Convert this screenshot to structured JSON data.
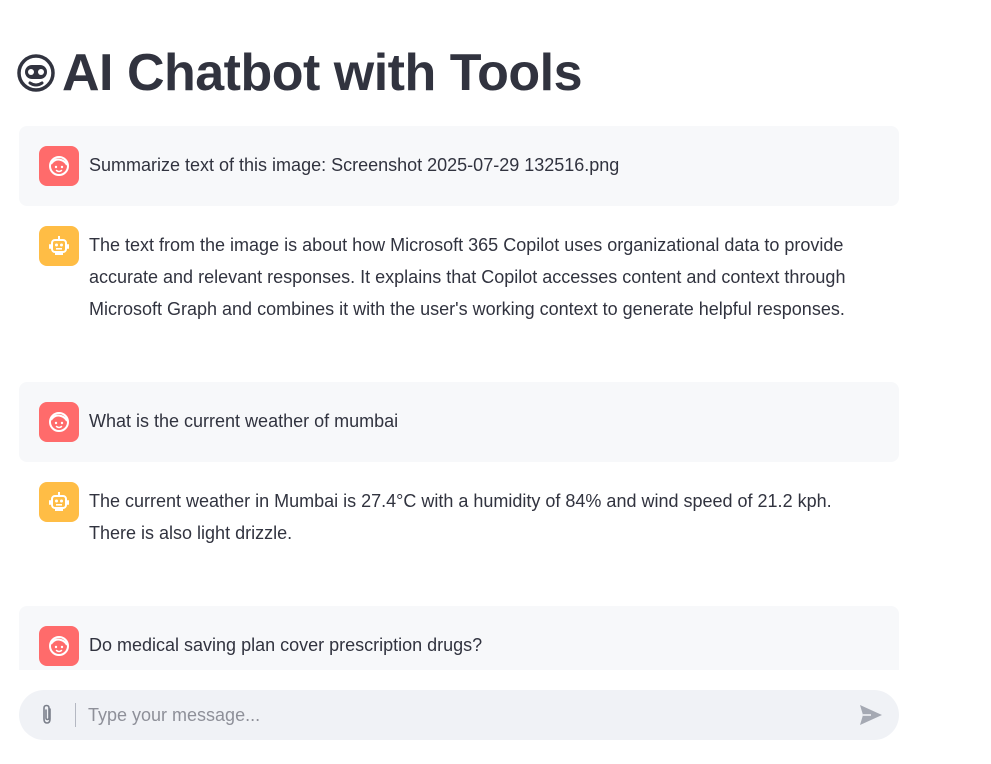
{
  "header": {
    "title": "AI Chatbot with Tools",
    "icon": "robot-face-icon"
  },
  "messages": [
    {
      "role": "user",
      "avatar_icon": "user-face-icon",
      "text": "Summarize text of this image: Screenshot 2025-07-29 132516.png"
    },
    {
      "role": "assistant",
      "avatar_icon": "robot-icon",
      "text": "The text from the image is about how Microsoft 365 Copilot uses organizational data to provide accurate and relevant responses. It explains that Copilot accesses content and context through Microsoft Graph and combines it with the user's working context to generate helpful responses."
    },
    {
      "role": "user",
      "avatar_icon": "user-face-icon",
      "text": "What is the current weather of mumbai"
    },
    {
      "role": "assistant",
      "avatar_icon": "robot-icon",
      "text": "The current weather in Mumbai is 27.4°C with a humidity of 84% and wind speed of 21.2 kph. There is also light drizzle."
    },
    {
      "role": "user",
      "avatar_icon": "user-face-icon",
      "text": "Do medical saving plan cover prescription drugs?"
    }
  ],
  "input": {
    "placeholder": "Type your message...",
    "value": "",
    "attach_icon": "paperclip-icon",
    "send_icon": "send-icon"
  },
  "colors": {
    "user_avatar": "#ff6b6b",
    "assistant_avatar": "#ffbd45",
    "user_bubble": "#f7f8fa",
    "input_background": "#f0f2f6",
    "text": "#31333f"
  }
}
